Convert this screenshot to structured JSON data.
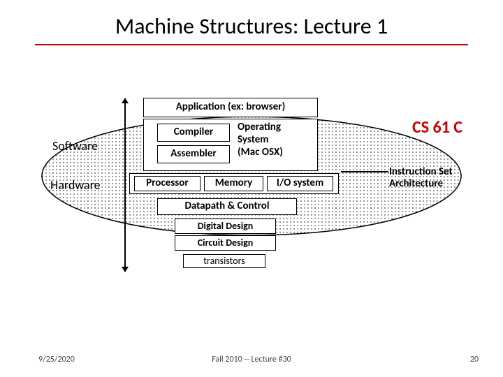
{
  "title": "Machine Structures: Lecture 1",
  "layers": {
    "application": "Application (ex: browser)",
    "compiler": "Compiler",
    "assembler": "Assembler",
    "os": "Operating\nSystem\n(Mac OSX)",
    "processor": "Processor",
    "memory": "Memory",
    "io": "I/O system",
    "datapath_control": "Datapath & Control",
    "digital_design": "Digital Design",
    "circuit_design": "Circuit Design",
    "transistors": "transistors"
  },
  "side": {
    "software": "Software",
    "hardware": "Hardware"
  },
  "callouts": {
    "course": "CS 61 C",
    "isa": "Instruction Set\nArchitecture"
  },
  "footer": {
    "date": "9/25/2020",
    "center": "Fall 2010 -- Lecture #30",
    "page": "20"
  }
}
